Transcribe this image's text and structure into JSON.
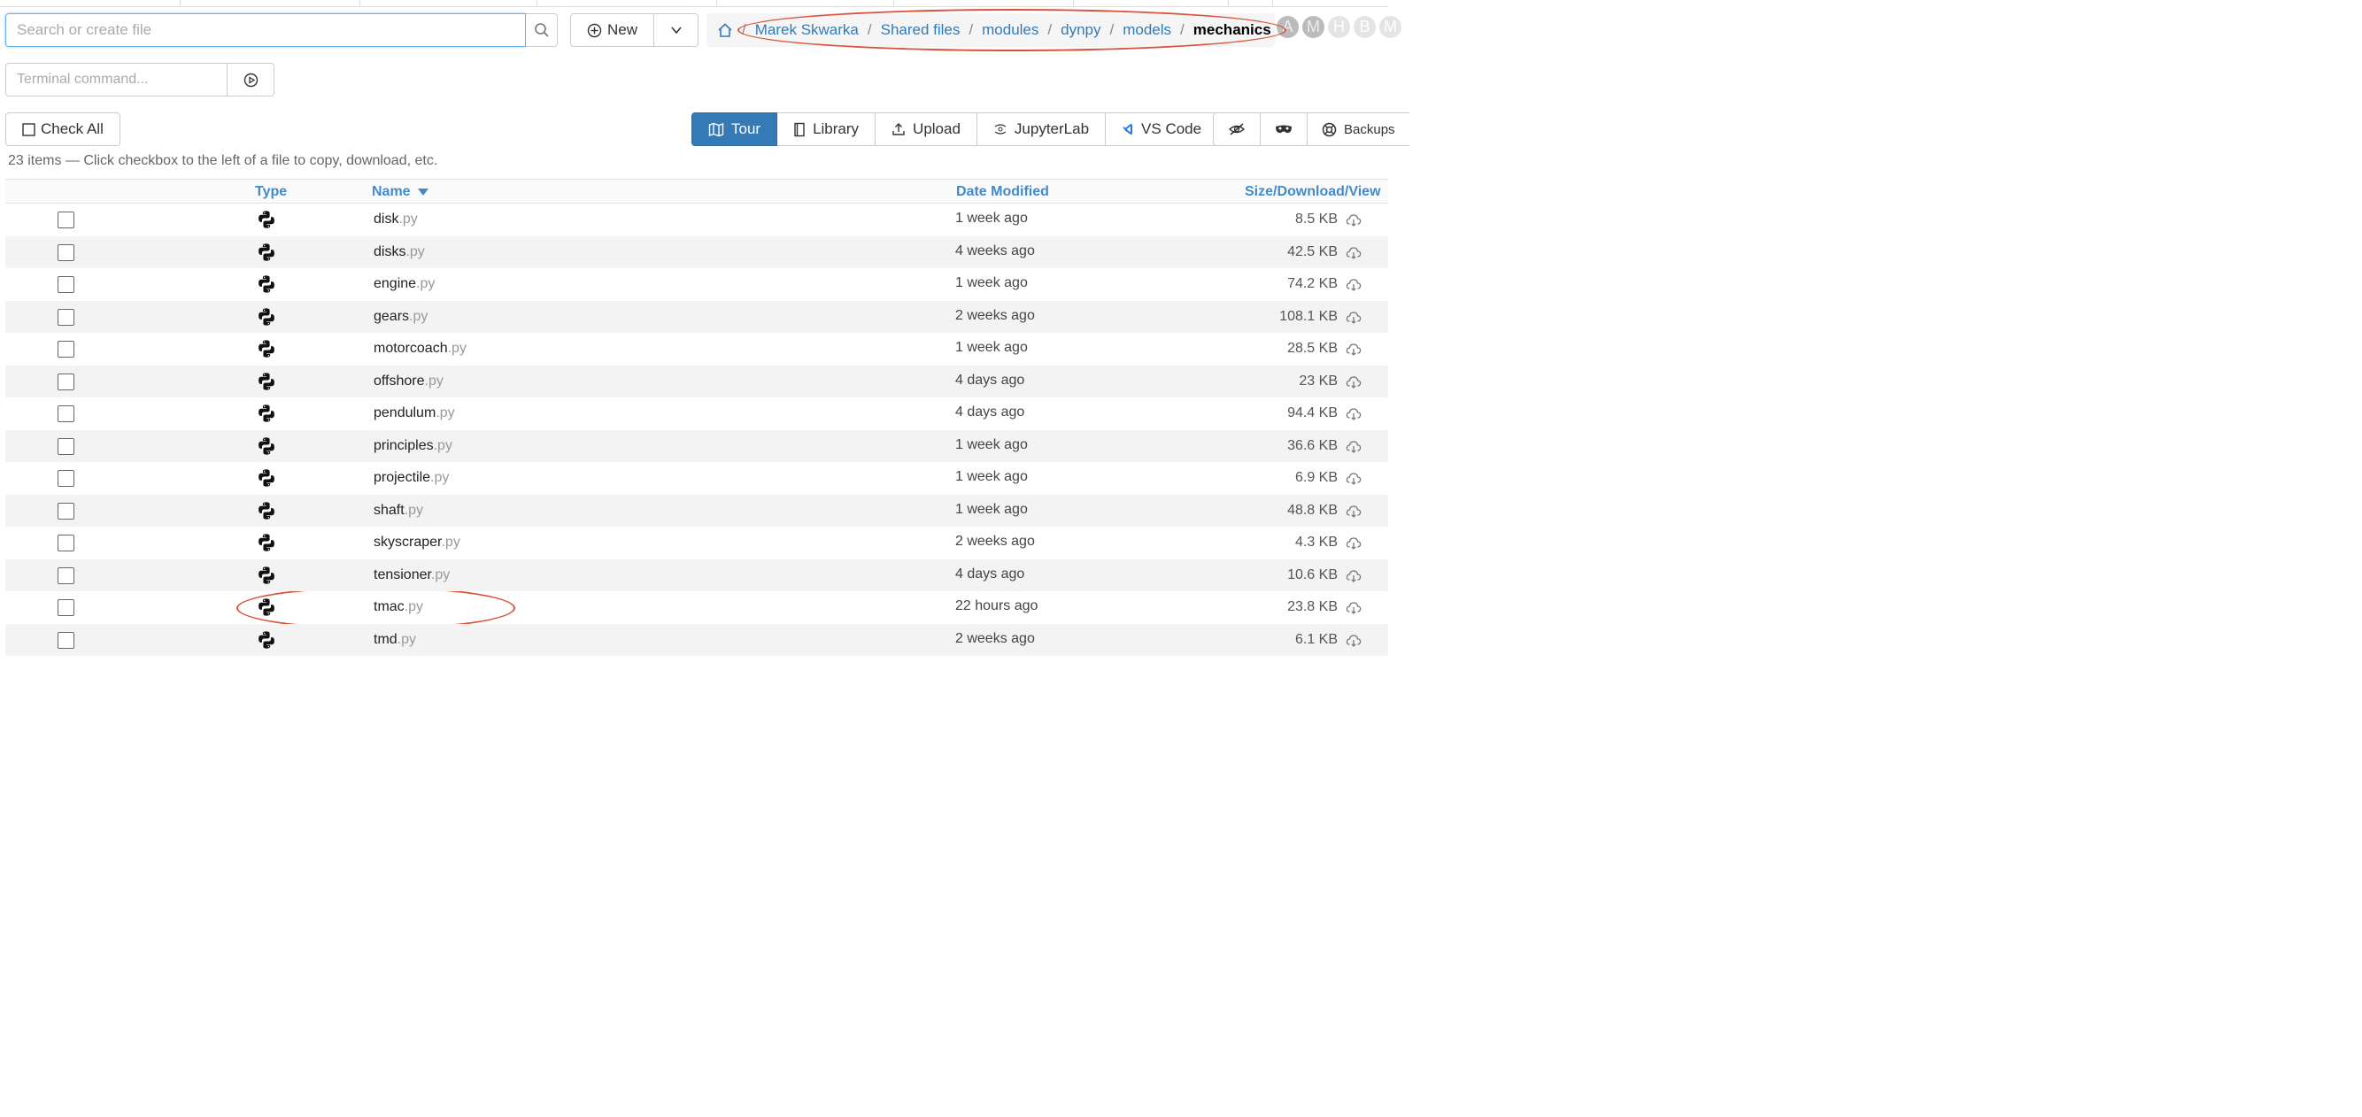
{
  "search": {
    "placeholder": "Search or create file"
  },
  "new_button": {
    "label": "New"
  },
  "breadcrumb": {
    "items": [
      "Marek Skwarka",
      "Shared files",
      "modules",
      "dynpy",
      "models"
    ],
    "current": "mechanics"
  },
  "avatars": [
    "A",
    "M",
    "H",
    "B",
    "M"
  ],
  "terminal": {
    "placeholder": "Terminal command..."
  },
  "check_all": {
    "label": "Check All"
  },
  "toolbar": {
    "tour": "Tour",
    "library": "Library",
    "upload": "Upload",
    "jupyterlab": "JupyterLab",
    "vscode": "VS Code",
    "backups": "Backups"
  },
  "summary": "23 items — Click checkbox to the left of a file to copy, download, etc.",
  "table": {
    "headers": {
      "type": "Type",
      "name": "Name",
      "date": "Date Modified",
      "size": "Size/Download/View"
    },
    "rows": [
      {
        "name": "disk",
        "ext": ".py",
        "date": "1 week ago",
        "size": "8.5 KB"
      },
      {
        "name": "disks",
        "ext": ".py",
        "date": "4 weeks ago",
        "size": "42.5 KB"
      },
      {
        "name": "engine",
        "ext": ".py",
        "date": "1 week ago",
        "size": "74.2 KB"
      },
      {
        "name": "gears",
        "ext": ".py",
        "date": "2 weeks ago",
        "size": "108.1 KB"
      },
      {
        "name": "motorcoach",
        "ext": ".py",
        "date": "1 week ago",
        "size": "28.5 KB"
      },
      {
        "name": "offshore",
        "ext": ".py",
        "date": "4 days ago",
        "size": "23 KB"
      },
      {
        "name": "pendulum",
        "ext": ".py",
        "date": "4 days ago",
        "size": "94.4 KB"
      },
      {
        "name": "principles",
        "ext": ".py",
        "date": "1 week ago",
        "size": "36.6 KB"
      },
      {
        "name": "projectile",
        "ext": ".py",
        "date": "1 week ago",
        "size": "6.9 KB"
      },
      {
        "name": "shaft",
        "ext": ".py",
        "date": "1 week ago",
        "size": "48.8 KB"
      },
      {
        "name": "skyscraper",
        "ext": ".py",
        "date": "2 weeks ago",
        "size": "4.3 KB"
      },
      {
        "name": "tensioner",
        "ext": ".py",
        "date": "4 days ago",
        "size": "10.6 KB"
      },
      {
        "name": "tmac",
        "ext": ".py",
        "date": "22 hours ago",
        "size": "23.8 KB"
      },
      {
        "name": "tmd",
        "ext": ".py",
        "date": "2 weeks ago",
        "size": "6.1 KB"
      }
    ]
  },
  "colors": {
    "accent": "#337ab7",
    "annotation": "#d9533b"
  },
  "icons": [
    "search-icon",
    "plus-circle-icon",
    "chevron-down-icon",
    "home-icon",
    "play-circle-icon",
    "checkbox-icon",
    "map-icon",
    "book-icon",
    "upload-icon",
    "jupyter-icon",
    "vscode-icon",
    "eye-slash-icon",
    "mask-icon",
    "lifebuoy-icon",
    "python-icon",
    "cloud-download-icon",
    "sort-down-icon"
  ]
}
